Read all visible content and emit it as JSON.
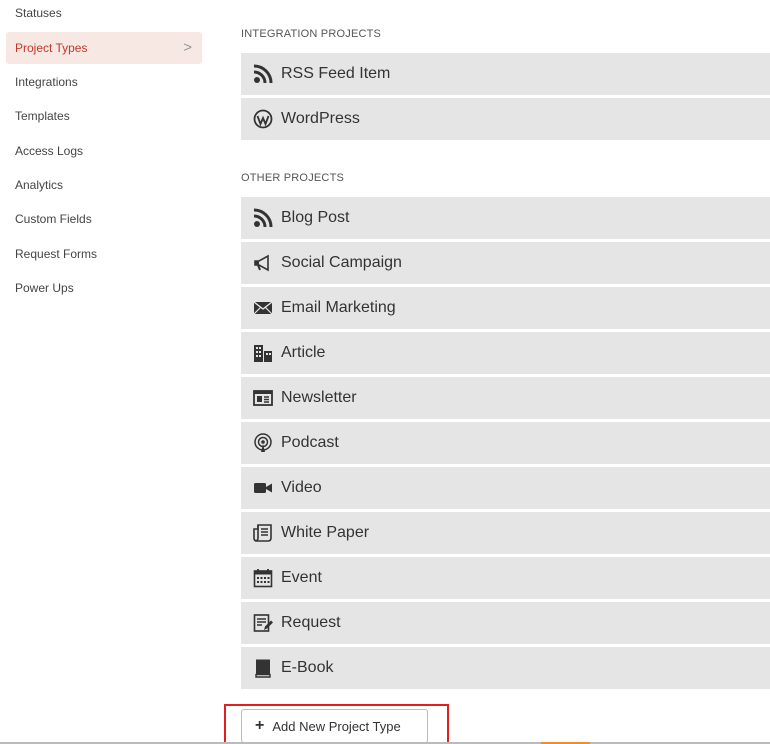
{
  "sidebar": {
    "items": [
      {
        "label": "Statuses",
        "active": false
      },
      {
        "label": "Project Types",
        "active": true
      },
      {
        "label": "Integrations",
        "active": false
      },
      {
        "label": "Templates",
        "active": false
      },
      {
        "label": "Access Logs",
        "active": false
      },
      {
        "label": "Analytics",
        "active": false
      },
      {
        "label": "Custom Fields",
        "active": false
      },
      {
        "label": "Request Forms",
        "active": false
      },
      {
        "label": "Power Ups",
        "active": false
      }
    ],
    "active_chevron": ">"
  },
  "sections": {
    "integration": {
      "title": "INTEGRATION PROJECTS",
      "items": [
        {
          "label": "RSS Feed Item",
          "icon": "rss-icon"
        },
        {
          "label": "WordPress",
          "icon": "wordpress-icon"
        }
      ]
    },
    "other": {
      "title": "OTHER PROJECTS",
      "items": [
        {
          "label": "Blog Post",
          "icon": "rss-icon"
        },
        {
          "label": "Social Campaign",
          "icon": "megaphone-icon"
        },
        {
          "label": "Email Marketing",
          "icon": "envelope-icon"
        },
        {
          "label": "Article",
          "icon": "buildings-icon"
        },
        {
          "label": "Newsletter",
          "icon": "newspaper-icon"
        },
        {
          "label": "Podcast",
          "icon": "podcast-icon"
        },
        {
          "label": "Video",
          "icon": "video-camera-icon"
        },
        {
          "label": "White Paper",
          "icon": "scroll-icon"
        },
        {
          "label": "Event",
          "icon": "calendar-icon"
        },
        {
          "label": "Request",
          "icon": "edit-form-icon"
        },
        {
          "label": "E-Book",
          "icon": "book-icon"
        }
      ]
    }
  },
  "add_button": {
    "label": "Add New Project Type",
    "icon": "plus-icon"
  },
  "colors": {
    "active_bg": "#f7e8e4",
    "active_text": "#c0392b",
    "item_bg": "#e5e5e5",
    "highlight": "#e0201e"
  }
}
